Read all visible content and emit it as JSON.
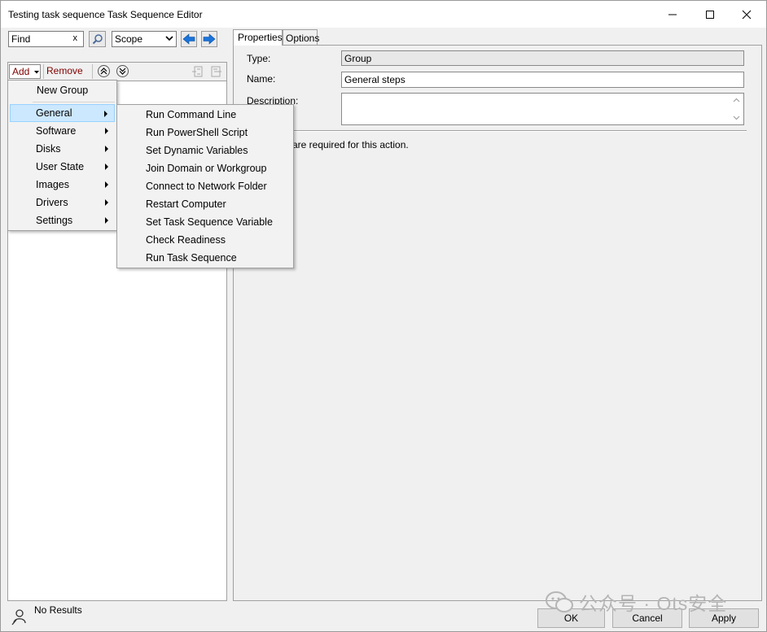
{
  "window": {
    "title": "Testing task sequence Task Sequence Editor"
  },
  "find_bar": {
    "find_value": "Find",
    "clear_label": "x",
    "scope_value": "Scope"
  },
  "left_toolbar": {
    "add_label": "Add",
    "remove_label": "Remove"
  },
  "add_menu": {
    "items": [
      {
        "label": "New Group"
      },
      {
        "label": "General"
      },
      {
        "label": "Software"
      },
      {
        "label": "Disks"
      },
      {
        "label": "User State"
      },
      {
        "label": "Images"
      },
      {
        "label": "Drivers"
      },
      {
        "label": "Settings"
      }
    ],
    "highlighted": "General"
  },
  "general_submenu": {
    "items": [
      {
        "label": "Run Command Line"
      },
      {
        "label": "Run PowerShell Script"
      },
      {
        "label": "Set Dynamic Variables"
      },
      {
        "label": "Join Domain or Workgroup"
      },
      {
        "label": "Connect to Network Folder"
      },
      {
        "label": "Restart Computer"
      },
      {
        "label": "Set Task Sequence Variable"
      },
      {
        "label": "Check Readiness"
      },
      {
        "label": "Run Task Sequence"
      }
    ]
  },
  "tabs": [
    {
      "label": "Properties",
      "active": true
    },
    {
      "label": "Options",
      "active": false
    }
  ],
  "properties": {
    "type_label": "Type:",
    "type_value": "Group",
    "name_label": "Name:",
    "name_value": "General steps",
    "description_label": "Description:",
    "description_value": "",
    "hint_text": "are required  for this action."
  },
  "status": {
    "text": "No Results"
  },
  "buttons": {
    "ok": "OK",
    "cancel": "Cancel",
    "apply": "Apply"
  },
  "watermark": {
    "text": "公众号 · Ots安全"
  },
  "colors": {
    "accent_blue": "#1a73d9",
    "menu_highlight": "#cce8ff",
    "link_red": "#800000"
  }
}
